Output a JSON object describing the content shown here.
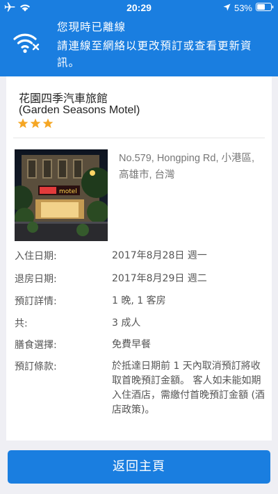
{
  "status_bar": {
    "time": "20:29",
    "battery": "53%",
    "icons": [
      "airplane-icon",
      "wifi-icon",
      "location-arrow-icon",
      "battery-icon"
    ]
  },
  "banner": {
    "icon": "wifi-off-icon",
    "title": "您現時已離線",
    "message": "請連線至網絡以更改預訂或查看更新資訊。"
  },
  "hotel": {
    "name": "花園四季汽車旅館",
    "name_en": "(Garden Seasons Motel)",
    "star_rating": 3,
    "address": "No.579, Hongping Rd, 小港區, 高雄市, 台灣",
    "photo_sign": "motel"
  },
  "details": [
    {
      "label": "入住日期:",
      "value": "2017年8月28日 週一"
    },
    {
      "label": "退房日期:",
      "value": "2017年8月29日 週二"
    },
    {
      "label": "預訂詳情:",
      "value": "1 晚, 1 客房"
    },
    {
      "label": "共:",
      "value": "3 成人"
    },
    {
      "label": "膳食選擇:",
      "value": "免費早餐"
    },
    {
      "label": "預訂條款:",
      "value": "於抵達日期前 1 天內取消預訂將收取首晚預訂金額。 客人如未能如期入住酒店，需繳付首晚預訂金額 (酒店政策)。"
    }
  ],
  "footer": {
    "home_button": "返回主頁"
  },
  "colors": {
    "accent": "#1a7ee0",
    "star": "#f5a623",
    "background": "#efeff4"
  }
}
